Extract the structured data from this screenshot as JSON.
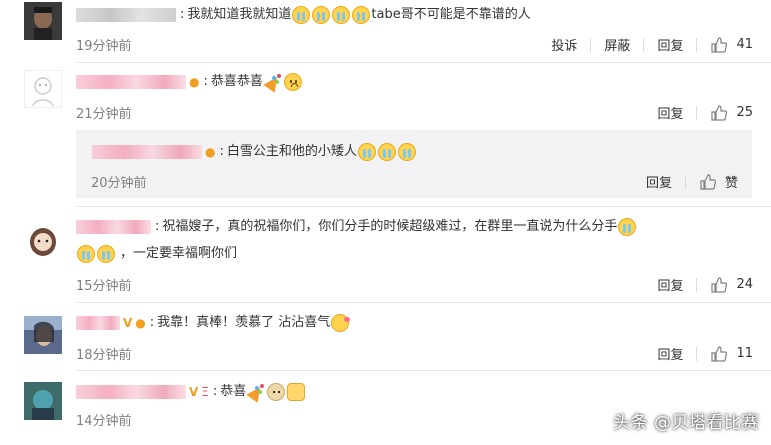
{
  "comments": [
    {
      "username": "Cavalleyoo PWA",
      "text_parts": [
        "我就知道我就知道",
        "tabe哥不可能是不靠谱的人"
      ],
      "emoji_names": [
        "cry-face",
        "cry-face",
        "cry-face",
        "cry-face"
      ],
      "time": "19分钟前",
      "report": "投诉",
      "block": "屏蔽",
      "reply": "回复",
      "likes": "41"
    },
    {
      "username": "SKJ ADHRHWH世界",
      "text": "恭喜恭喜",
      "emoji_names": [
        "party-popper",
        "sad-face"
      ],
      "time": "21分钟前",
      "reply": "回复",
      "likes": "25"
    },
    {
      "username": "阿 JJL阿猫HHJHJ九",
      "text": "白雪公主和他的小矮人",
      "emoji_names": [
        "cry-face",
        "cry-face",
        "cry-face"
      ],
      "time": "20分钟前",
      "reply": "回复",
      "likes": "赞"
    },
    {
      "username": "Cedmoooo",
      "text": "祝福嫂子，真的祝福你们，你们分手的时候超级难过，在群里一直说为什么分手",
      "text2": "一定要幸福啊你们",
      "emoji_names": [
        "cry-face",
        "cry-face",
        "cry-face"
      ],
      "time": "15分钟前",
      "reply": "回复",
      "likes": "24"
    },
    {
      "username": "Jkr Tr",
      "text": "我靠！真棒！羡慕了 沾沾喜气",
      "emoji_names": [
        "kiss-face"
      ],
      "time": "18分钟前",
      "reply": "回复",
      "likes": "11"
    },
    {
      "username": "小ZJAMT JJH",
      "text": "恭喜",
      "emoji_names": [
        "party-popper",
        "dog-face",
        "thumbs-up"
      ],
      "time": "14分钟前",
      "reply": "回复",
      "likes": ""
    }
  ],
  "watermark": "头条 @贝塔看比赛",
  "colors": {
    "link_gray": "#808080",
    "reply_bg": "#f2f2f5",
    "divider": "#e6e6e6",
    "badge": "#f0a020"
  }
}
